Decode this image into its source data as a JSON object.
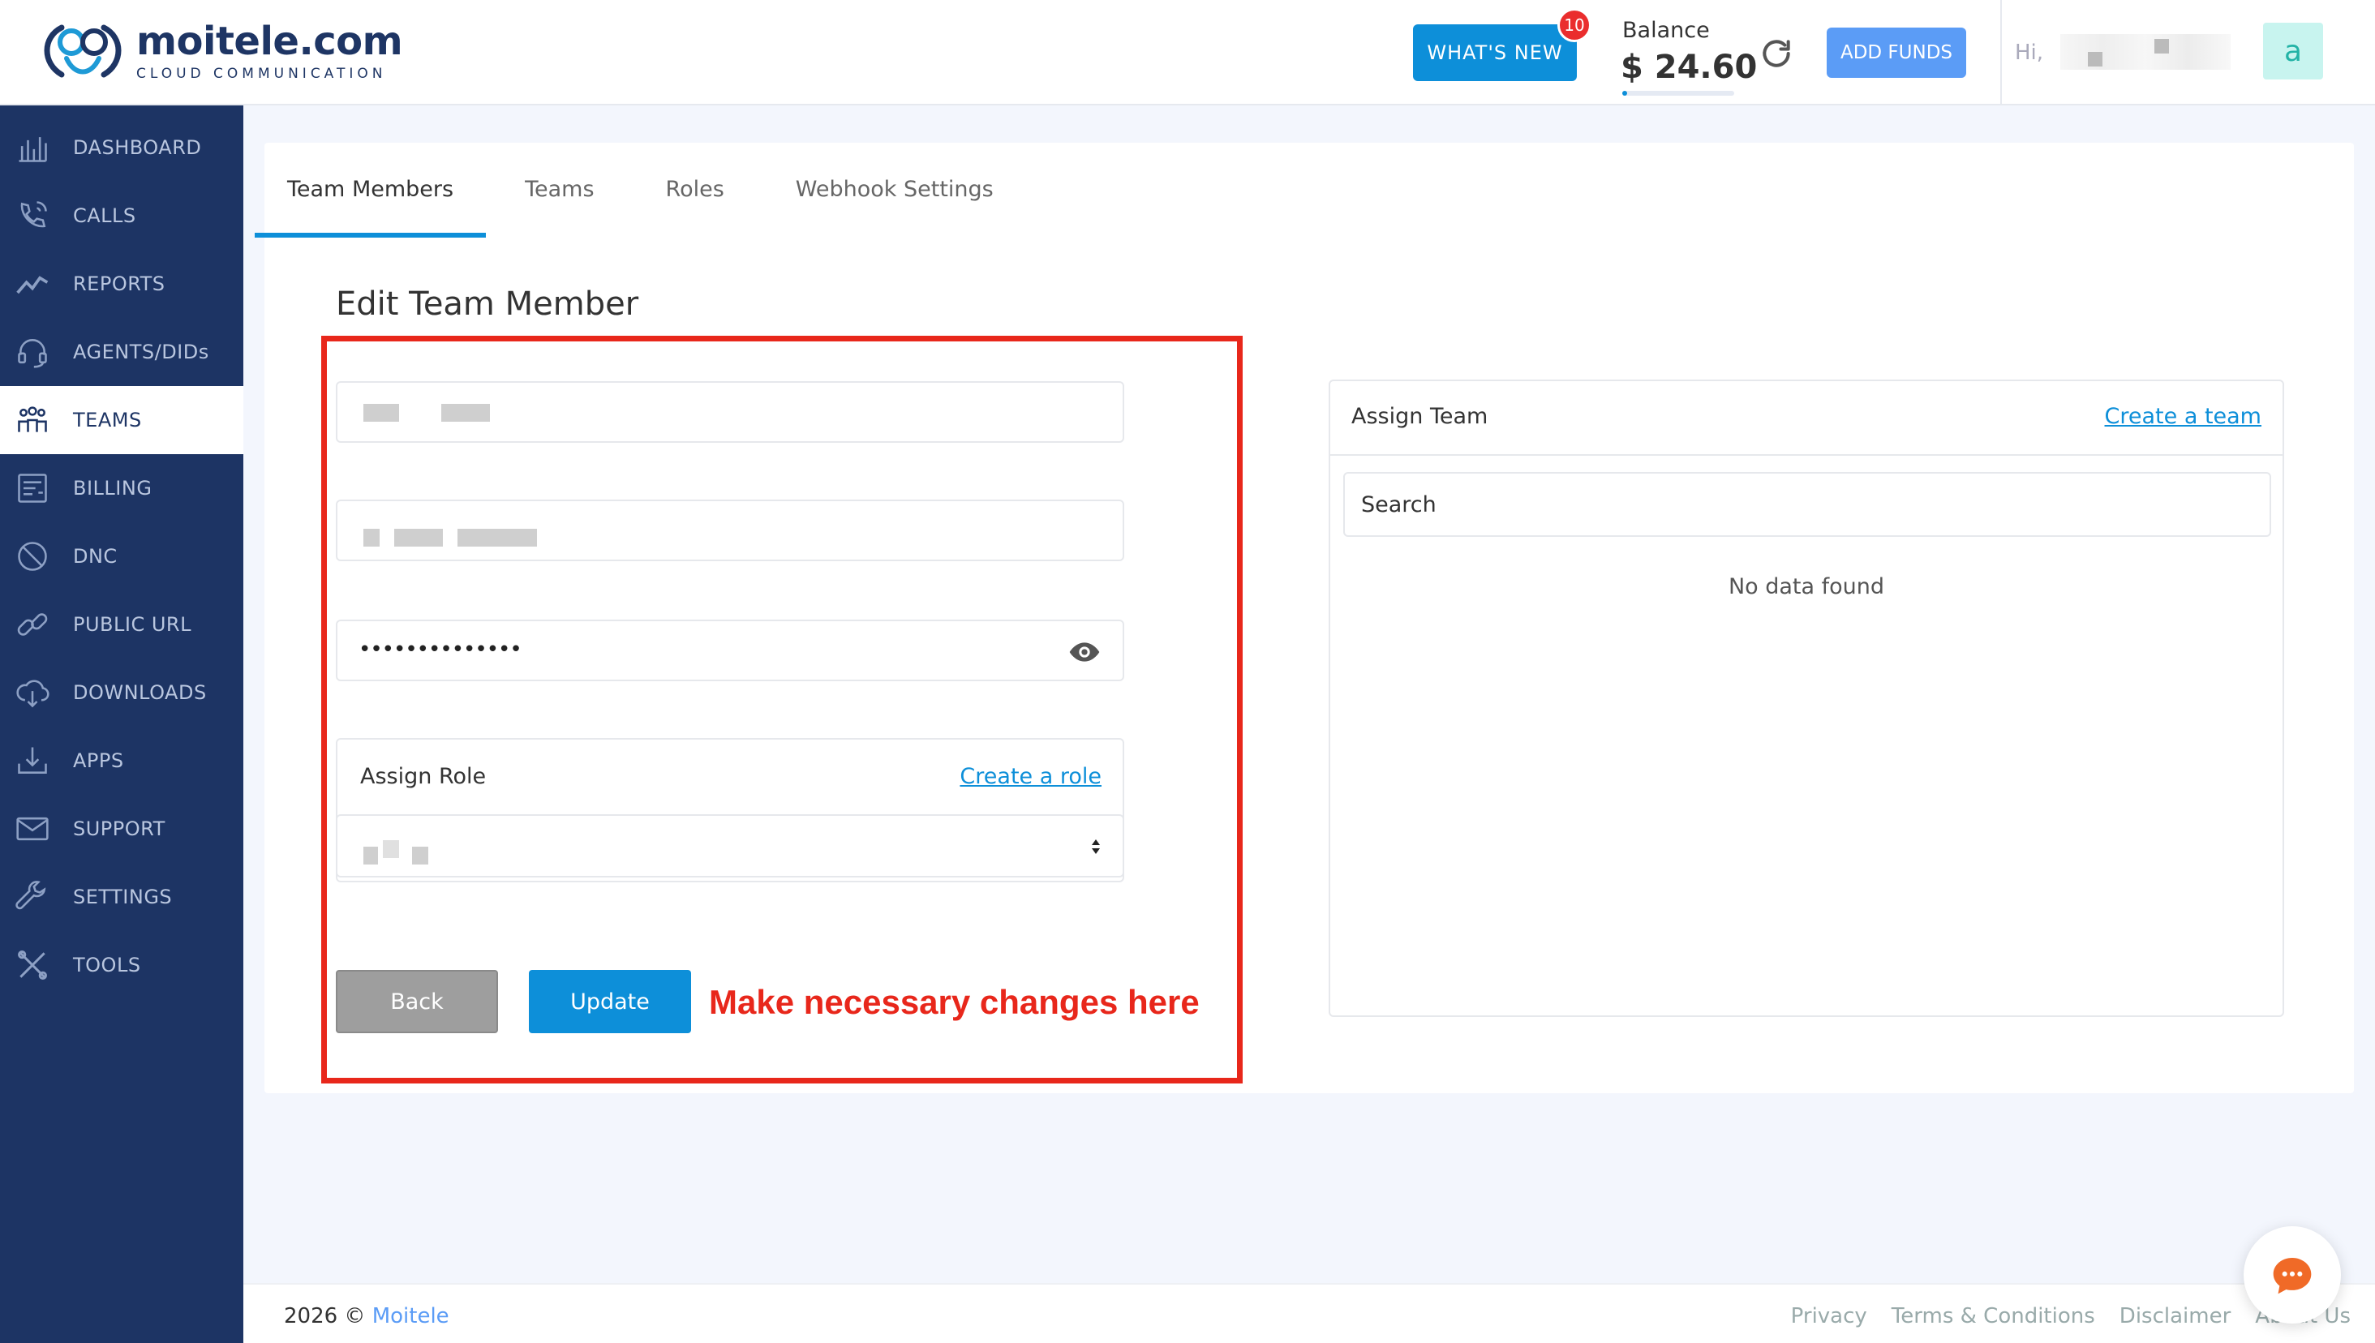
{
  "header": {
    "logo_name": "moitele.com",
    "logo_tagline": "CLOUD COMMUNICATION",
    "whats_new_label": "WHAT'S NEW",
    "whats_new_count": "10",
    "balance_label": "Balance",
    "balance_value": "$ 24.60",
    "add_funds_label": "ADD FUNDS",
    "greeting": "Hi,",
    "avatar_letter": "a"
  },
  "sidebar": {
    "items": [
      {
        "label": "DASHBOARD",
        "icon": "dashboard-icon"
      },
      {
        "label": "CALLS",
        "icon": "calls-icon"
      },
      {
        "label": "REPORTS",
        "icon": "reports-icon"
      },
      {
        "label": "AGENTS/DIDs",
        "icon": "headset-icon"
      },
      {
        "label": "TEAMS",
        "icon": "teams-icon",
        "active": true
      },
      {
        "label": "BILLING",
        "icon": "billing-icon"
      },
      {
        "label": "DNC",
        "icon": "dnc-icon"
      },
      {
        "label": "PUBLIC URL",
        "icon": "link-icon"
      },
      {
        "label": "DOWNLOADS",
        "icon": "cloud-download-icon"
      },
      {
        "label": "APPS",
        "icon": "apps-icon"
      },
      {
        "label": "SUPPORT",
        "icon": "mail-icon"
      },
      {
        "label": "SETTINGS",
        "icon": "wrench-icon"
      },
      {
        "label": "TOOLS",
        "icon": "tools-icon"
      }
    ]
  },
  "tabs": [
    "Team Members",
    "Teams",
    "Roles",
    "Webhook Settings"
  ],
  "form": {
    "title": "Edit Team Member",
    "password_mask": "••••••••••••••",
    "assign_role_label": "Assign Role",
    "create_role_link": "Create a role",
    "back_label": "Back",
    "update_label": "Update",
    "annotation": "Make necessary changes here"
  },
  "assign_team": {
    "title": "Assign Team",
    "create_link": "Create a team",
    "search_placeholder": "Search",
    "empty_text": "No data found"
  },
  "footer": {
    "year": "2026 ©",
    "brand": "Moitele",
    "links": [
      "Privacy",
      "Terms & Conditions",
      "Disclaimer",
      "About Us"
    ]
  },
  "colors": {
    "primary": "#0d8fd9",
    "sidebar": "#1d3464",
    "annotation": "#e8271b"
  }
}
